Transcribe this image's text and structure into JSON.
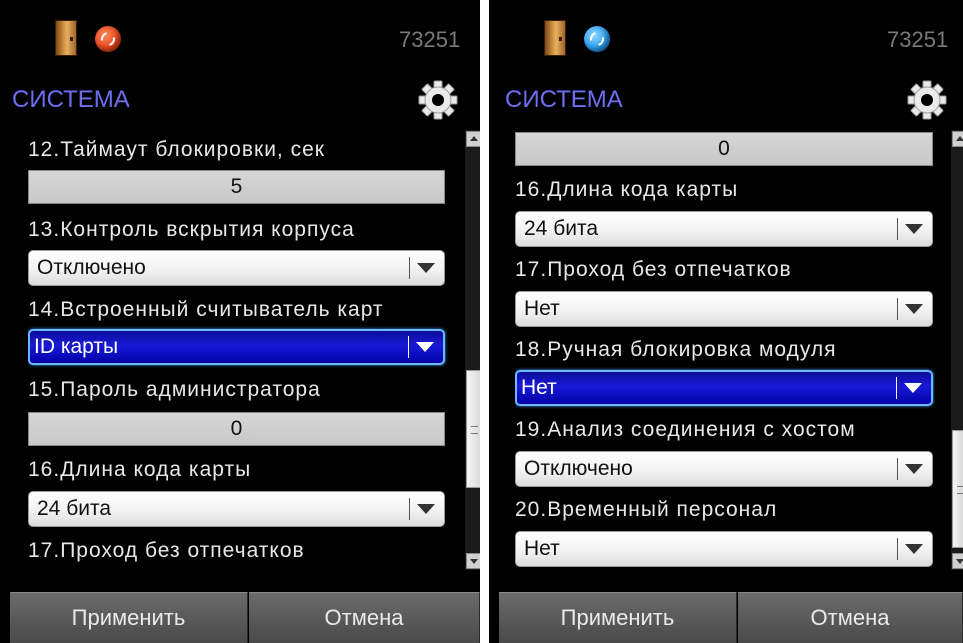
{
  "colors": {
    "accent": "#6e6ef0",
    "selection": "#0000c8",
    "background": "#000000",
    "button": "#5a5a5a"
  },
  "left": {
    "status": {
      "device_id": "73251",
      "door_icon": "door-icon",
      "sync_icon": "sync-icon",
      "sync_color": "#e8481e"
    },
    "title": "СИСТЕМА",
    "settings_icon": "gear-icon",
    "items": {
      "i12": {
        "label": "12.Таймаут блокировки, сек",
        "value": "5"
      },
      "i13": {
        "label": "13.Контроль вскрытия корпуса",
        "value": "Отключено"
      },
      "i14": {
        "label": "14.Встроенный считыватель карт",
        "value": "ID карты"
      },
      "i15": {
        "label": "15.Пароль администратора",
        "value": "0"
      },
      "i16": {
        "label": "16.Длина кода карты",
        "value": "24 бита"
      },
      "i17": {
        "label": "17.Проход без отпечатков"
      }
    },
    "buttons": {
      "apply": "Применить",
      "cancel": "Отмена"
    }
  },
  "right": {
    "status": {
      "device_id": "73251",
      "door_icon": "door-icon",
      "sync_icon": "sync-icon",
      "sync_color": "#2ea0ee"
    },
    "title": "СИСТЕМА",
    "settings_icon": "gear-icon",
    "items": {
      "i15": {
        "value": "0"
      },
      "i16": {
        "label": "16.Длина кода карты",
        "value": "24 бита"
      },
      "i17": {
        "label": "17.Проход без отпечатков",
        "value": "Нет"
      },
      "i18": {
        "label": "18.Ручная блокировка модуля",
        "value": "Нет"
      },
      "i19": {
        "label": "19.Анализ соединения с хостом",
        "value": "Отключено"
      },
      "i20": {
        "label": "20.Временный персонал",
        "value": "Нет"
      }
    },
    "buttons": {
      "apply": "Применить",
      "cancel": "Отмена"
    }
  }
}
